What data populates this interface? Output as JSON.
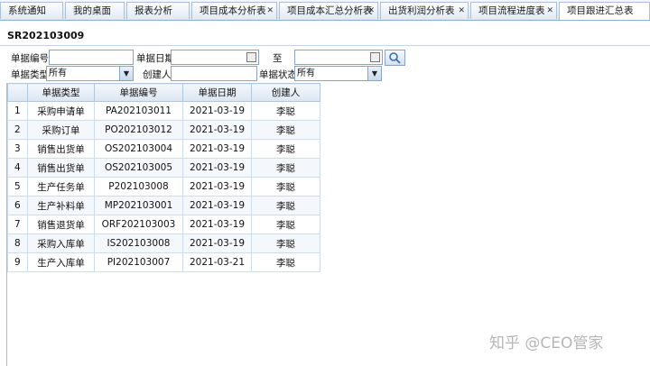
{
  "tabs": [
    {
      "label": "系统通知",
      "closable": false
    },
    {
      "label": "我的桌面",
      "closable": false
    },
    {
      "label": "报表分析",
      "closable": false
    },
    {
      "label": "项目成本分析表",
      "closable": true
    },
    {
      "label": "项目成本汇总分析表",
      "closable": true
    },
    {
      "label": "出货利润分析表",
      "closable": true
    },
    {
      "label": "项目流程进度表",
      "closable": true
    },
    {
      "label": "项目跟进汇总表",
      "closable": false
    }
  ],
  "doc_title": "SR202103009",
  "filters": {
    "doc_no_label": "单据编号:",
    "doc_no_value": "",
    "date_label": "单据日期:",
    "date_from": "",
    "to_label": "至",
    "date_to": "",
    "type_label": "单据类型:",
    "type_value": "所有",
    "creator_label": "创建人:",
    "creator_value": "",
    "status_label": "单据状态:",
    "status_value": "所有"
  },
  "grid": {
    "columns": [
      "",
      "单据类型",
      "单据编号",
      "单据日期",
      "创建人"
    ],
    "rows": [
      [
        "1",
        "采购申请单",
        "PA202103011",
        "2021-03-19",
        "李聪"
      ],
      [
        "2",
        "采购订单",
        "PO202103012",
        "2021-03-19",
        "李聪"
      ],
      [
        "3",
        "销售出货单",
        "OS202103004",
        "2021-03-19",
        "李聪"
      ],
      [
        "4",
        "销售出货单",
        "OS202103005",
        "2021-03-19",
        "李聪"
      ],
      [
        "5",
        "生产任务单",
        "P202103008",
        "2021-03-19",
        "李聪"
      ],
      [
        "6",
        "生产补料单",
        "MP202103001",
        "2021-03-19",
        "李聪"
      ],
      [
        "7",
        "销售退货单",
        "ORF202103003",
        "2021-03-19",
        "李聪"
      ],
      [
        "8",
        "采购入库单",
        "IS202103008",
        "2021-03-19",
        "李聪"
      ],
      [
        "9",
        "生产入库单",
        "PI202103007",
        "2021-03-21",
        "李聪"
      ]
    ]
  },
  "watermark": "知乎 @CEO管家"
}
